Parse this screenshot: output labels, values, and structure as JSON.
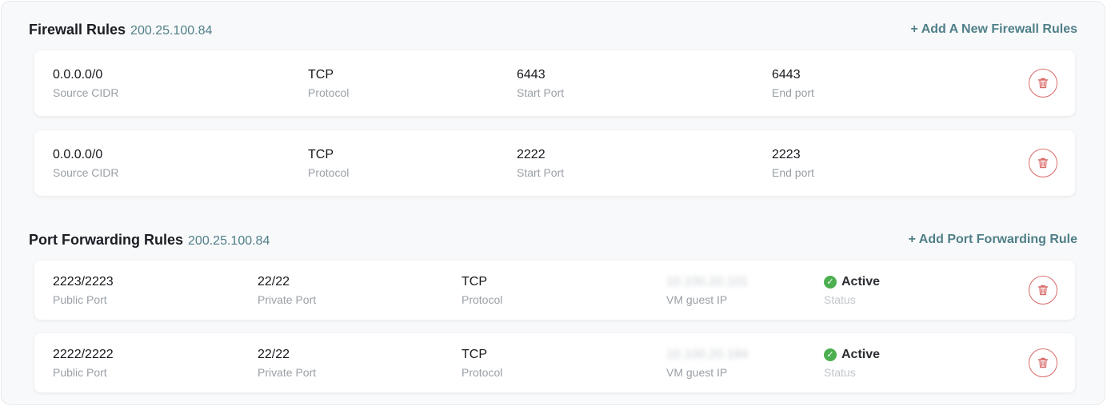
{
  "firewall": {
    "title": "Firewall Rules",
    "ip": "200.25.100.84",
    "add_label": "+ Add A New Firewall Rules",
    "rules": [
      {
        "source_cidr": "0.0.0.0/0",
        "source_label": "Source CIDR",
        "protocol": "TCP",
        "protocol_label": "Protocol",
        "start_port": "6443",
        "start_label": "Start Port",
        "end_port": "6443",
        "end_label": "End port"
      },
      {
        "source_cidr": "0.0.0.0/0",
        "source_label": "Source CIDR",
        "protocol": "TCP",
        "protocol_label": "Protocol",
        "start_port": "2222",
        "start_label": "Start Port",
        "end_port": "2223",
        "end_label": "End port"
      }
    ]
  },
  "port_forwarding": {
    "title": "Port Forwarding Rules",
    "ip": "200.25.100.84",
    "add_label": "+ Add Port Forwarding Rule",
    "rules": [
      {
        "public_port": "2223/2223",
        "public_label": "Public Port",
        "private_port": "22/22",
        "private_label": "Private Port",
        "protocol": "TCP",
        "protocol_label": "Protocol",
        "vm_ip": "10.100.20.101",
        "vm_ip_label": "VM guest IP",
        "status": "Active",
        "status_label": "Status"
      },
      {
        "public_port": "2222/2222",
        "public_label": "Public Port",
        "private_port": "22/22",
        "private_label": "Private Port",
        "protocol": "TCP",
        "protocol_label": "Protocol",
        "vm_ip": "10.100.20.184",
        "vm_ip_label": "VM guest IP",
        "status": "Active",
        "status_label": "Status"
      }
    ]
  },
  "colors": {
    "accent": "#4f7f88",
    "danger": "#d96a6a",
    "success": "#4caf50"
  },
  "icons": {
    "delete": "trash-icon",
    "status": "check-circle-icon"
  }
}
